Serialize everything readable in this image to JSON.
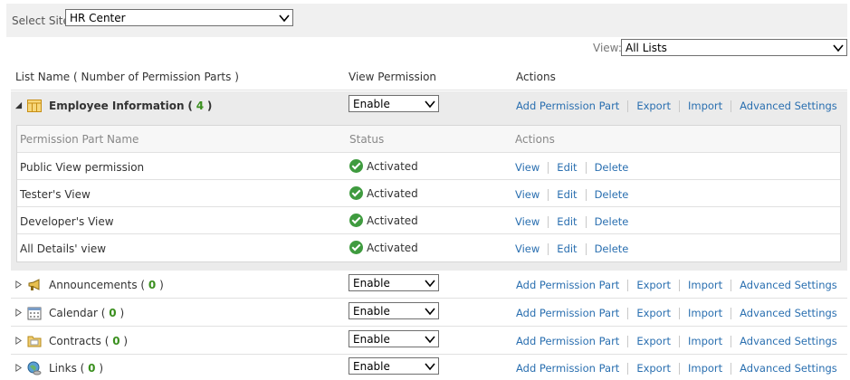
{
  "site_selector": {
    "label": "Select Site:",
    "value": "HR Center"
  },
  "view_selector": {
    "label": "View:",
    "value": "All Lists"
  },
  "columns": {
    "list_name": "List Name ( Number of Permission Parts )",
    "view_permission": "View Permission",
    "actions": "Actions"
  },
  "action_labels": {
    "add": "Add Permission Part",
    "export": "Export",
    "import": "Import",
    "advanced": "Advanced Settings"
  },
  "row_action_labels": {
    "view": "View",
    "edit": "Edit",
    "delete": "Delete"
  },
  "lists": [
    {
      "name": "Employee Information",
      "count": "4",
      "permission": "Enable",
      "expanded": true,
      "icon": "table-icon"
    },
    {
      "name": "Announcements",
      "count": "0",
      "permission": "Enable",
      "expanded": false,
      "icon": "megaphone-icon"
    },
    {
      "name": "Calendar",
      "count": "0",
      "permission": "Enable",
      "expanded": false,
      "icon": "calendar-icon"
    },
    {
      "name": "Contracts",
      "count": "0",
      "permission": "Enable",
      "expanded": false,
      "icon": "folder-icon"
    },
    {
      "name": "Links",
      "count": "0",
      "permission": "Enable",
      "expanded": false,
      "icon": "globe-link-icon"
    }
  ],
  "permission_parts": {
    "columns": {
      "name": "Permission Part Name",
      "status": "Status",
      "actions": "Actions"
    },
    "rows": [
      {
        "name": "Public View permission",
        "status": "Activated"
      },
      {
        "name": "Tester's View",
        "status": "Activated"
      },
      {
        "name": "Developer's View",
        "status": "Activated"
      },
      {
        "name": "All Details' view",
        "status": "Activated"
      }
    ]
  },
  "colors": {
    "link": "#2a6fb0",
    "count": "#3a8f1e",
    "activated": "#3f9b3f",
    "panel": "#ebebeb"
  }
}
